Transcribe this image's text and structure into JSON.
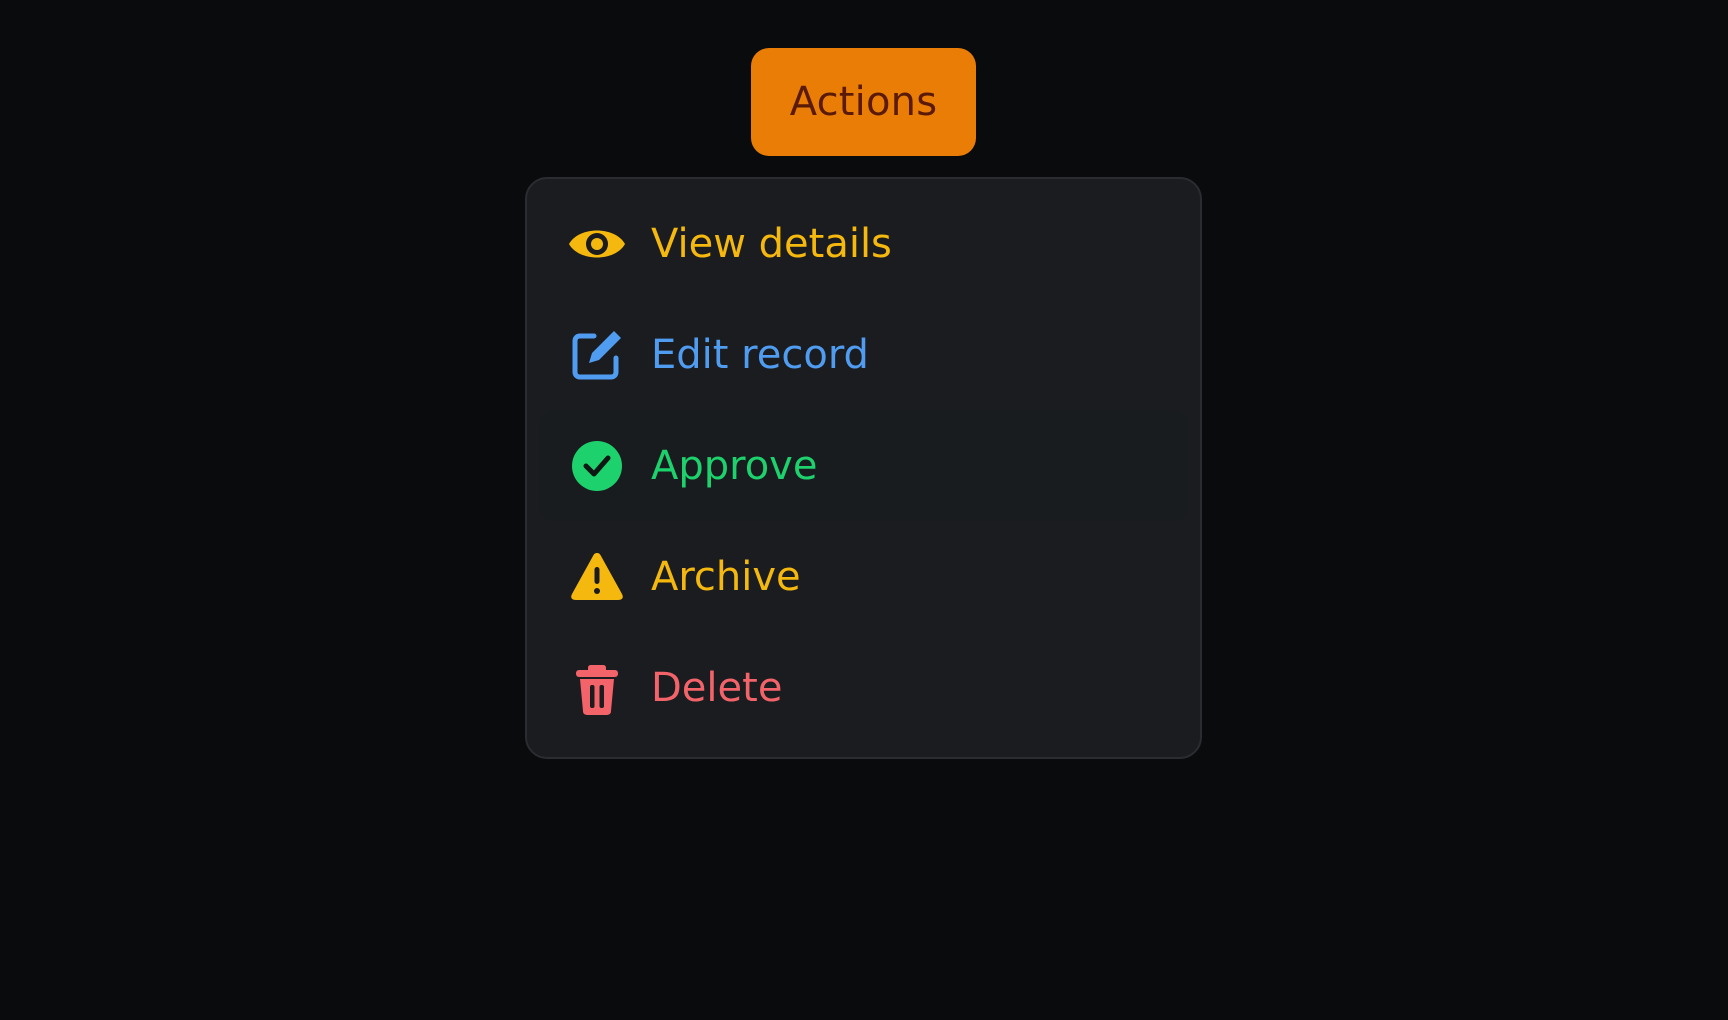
{
  "button": {
    "label": "Actions",
    "color": "#ea7d05",
    "text_color": "#5a1a06"
  },
  "menu": {
    "items": [
      {
        "label": "View details",
        "icon": "eye-icon",
        "color": "#f5b80e"
      },
      {
        "label": "Edit record",
        "icon": "edit-icon",
        "color": "#4f9cf0"
      },
      {
        "label": "Approve",
        "icon": "check-circle-icon",
        "color": "#1dd16c",
        "highlighted": true
      },
      {
        "label": "Archive",
        "icon": "warning-icon",
        "color": "#f5b80e"
      },
      {
        "label": "Delete",
        "icon": "trash-icon",
        "color": "#f2636a"
      }
    ]
  }
}
